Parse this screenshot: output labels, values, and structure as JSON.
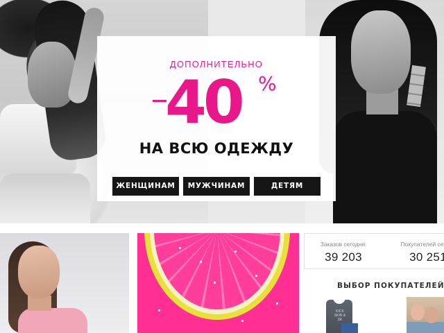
{
  "promo": {
    "subtitle": "ДОПОЛНИТЕЛЬНО",
    "dash": "–",
    "discount": "40",
    "percent": "%",
    "headline": "НА ВСЮ ОДЕЖДУ",
    "accent_color": "#e9188a"
  },
  "categories": [
    {
      "label": "ЖЕНЩИНАМ"
    },
    {
      "label": "МУЖЧИНАМ"
    },
    {
      "label": "ДЕТЯМ"
    }
  ],
  "stats": {
    "orders_label": "Заказов сегодня:",
    "orders_value": "39 203",
    "buyers_label": "Покупателей сегодн",
    "buyers_value": "30 251"
  },
  "buyers_choice": {
    "title": "ВЫБОР ПОКУПАТЕЛЕЙ",
    "shirt_print": "KICK SKIN & SK"
  }
}
